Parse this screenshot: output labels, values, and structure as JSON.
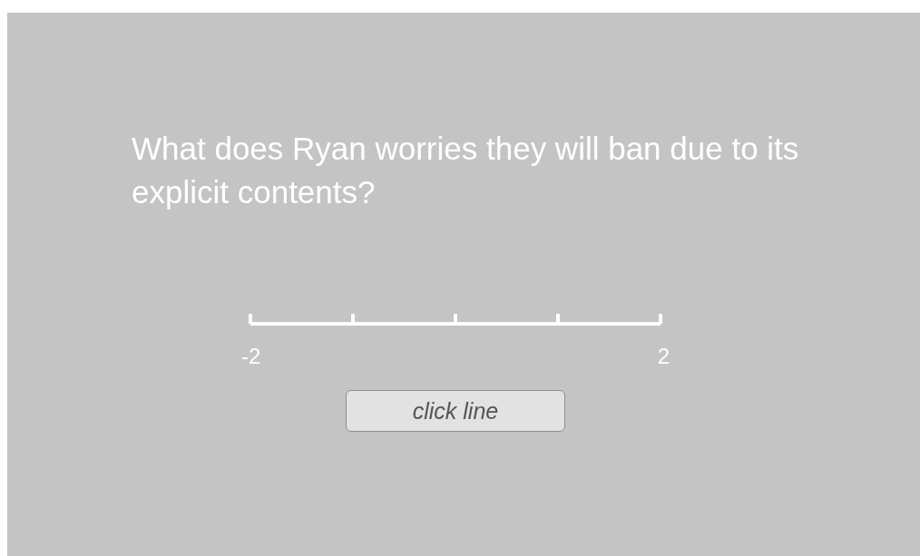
{
  "question": "What does Ryan worries they will ban due to its explicit contents?",
  "scale": {
    "min_label": "-2",
    "max_label": "2"
  },
  "button": {
    "label": "click line"
  }
}
